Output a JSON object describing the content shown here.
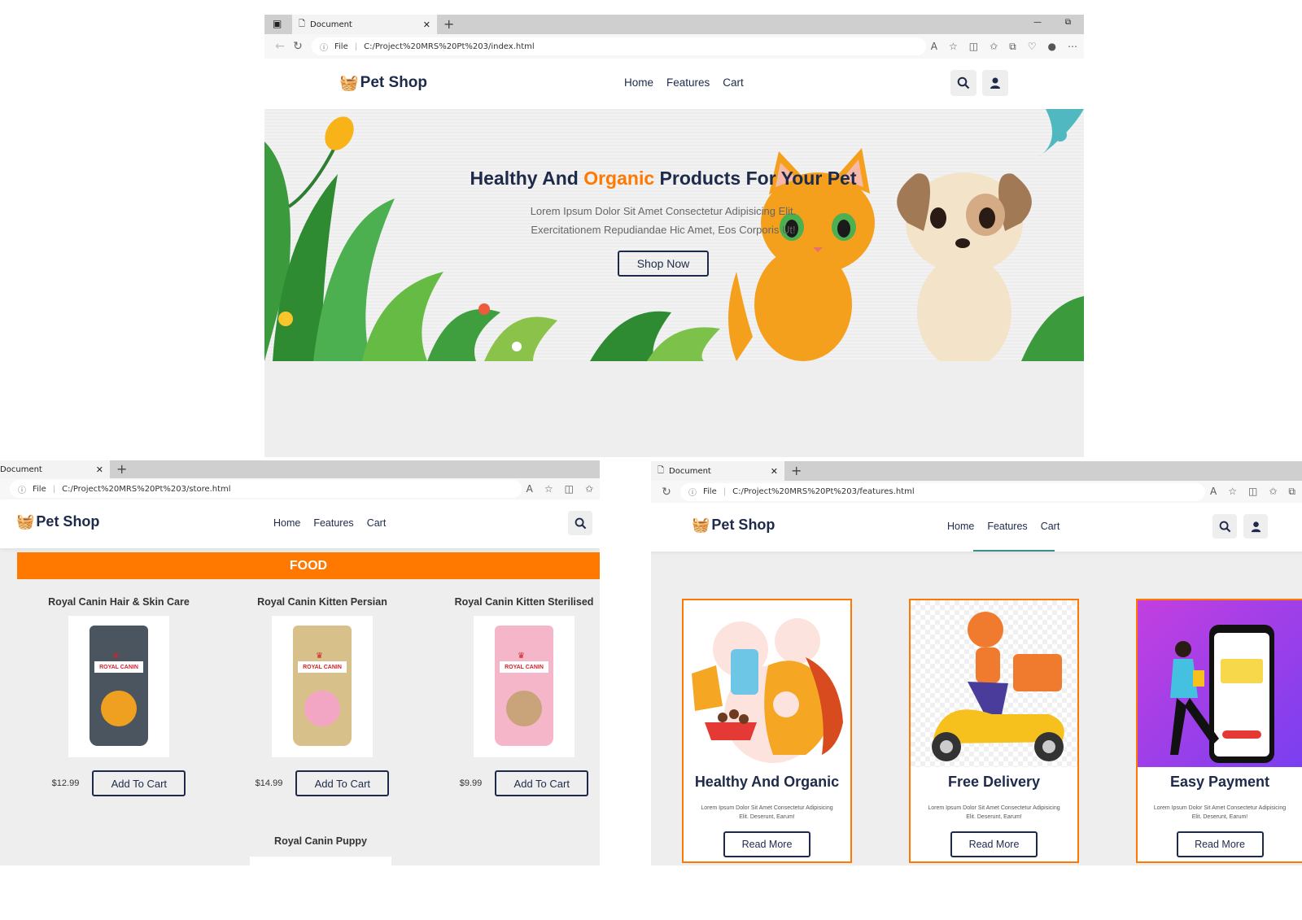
{
  "colors": {
    "accent": "#ff7800",
    "navy": "#1e2a4a",
    "page_bg": "#eeeeee"
  },
  "main_window": {
    "tab_title": "Document",
    "url": "C:/Project%20MRS%20Pt%203/index.html",
    "url_prefix": "File",
    "logo": "Pet Shop",
    "nav": [
      "Home",
      "Features",
      "Cart"
    ],
    "hero": {
      "title_part1": "Healthy And",
      "title_highlight": "Organic",
      "title_part2": "Products For Your Pet",
      "description": "Lorem Ipsum Dolor Sit Amet Consectetur Adipisicing Elit. Exercitationem Repudiandae Hic Amet, Eos Corporis Ut!",
      "button": "Shop Now"
    }
  },
  "store_window": {
    "tab_title": "Document",
    "url": "C:/Project%20MRS%20Pt%203/store.html",
    "url_prefix": "File",
    "logo": "Pet Shop",
    "nav": [
      "Home",
      "Features",
      "Cart"
    ],
    "section_title": "FOOD",
    "products": [
      {
        "name": "Royal Canin Hair & Skin Care",
        "price": "$12.99",
        "button": "Add To Cart",
        "brand": "ROYAL CANIN"
      },
      {
        "name": "Royal Canin Kitten Persian",
        "price": "$14.99",
        "button": "Add To Cart",
        "brand": "ROYAL CANIN"
      },
      {
        "name": "Royal Canin Kitten Sterilised",
        "price": "$9.99",
        "button": "Add To Cart",
        "brand": "ROYAL CANIN"
      }
    ],
    "next_product": "Royal Canin Puppy"
  },
  "features_window": {
    "tab_title": "Document",
    "url": "C:/Project%20MRS%20Pt%203/features.html",
    "url_prefix": "File",
    "logo": "Pet Shop",
    "nav": [
      "Home",
      "Features",
      "Cart"
    ],
    "cards": [
      {
        "title": "Healthy And Organic",
        "description": "Lorem Ipsum Dolor Sit Amet Consectetur Adipisicing Elit. Deserunt, Earum!",
        "button": "Read More"
      },
      {
        "title": "Free Delivery",
        "description": "Lorem Ipsum Dolor Sit Amet Consectetur Adipisicing Elit. Deserunt, Earum!",
        "button": "Read More"
      },
      {
        "title": "Easy Payment",
        "description": "Lorem Ipsum Dolor Sit Amet Consectetur Adipisicing Elit. Deserunt, Earum!",
        "button": "Read More"
      }
    ]
  }
}
